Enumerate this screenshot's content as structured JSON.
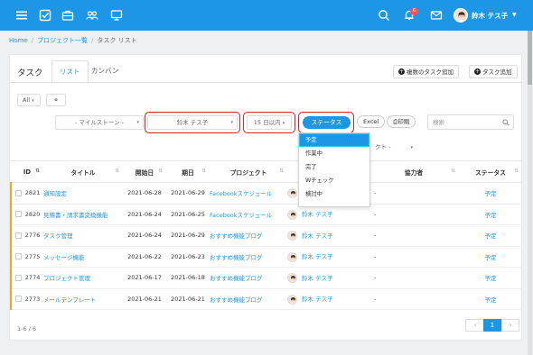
{
  "topbar": {
    "icons": [
      "menu-icon",
      "task-check-icon",
      "briefcase-icon",
      "users-icon",
      "monitor-icon",
      "search-icon",
      "bell-icon",
      "mail-icon"
    ],
    "notification_count": "6",
    "user_name": "鈴木 テス子",
    "accent_color": "#1e96e6"
  },
  "breadcrumb": {
    "home": "Home",
    "projects": "プロジェクト一覧",
    "current": "タスク リスト"
  },
  "page": {
    "title": "タスク",
    "tabs": [
      "リスト",
      "カンバン"
    ],
    "add_multiple": "複数のタスク追加",
    "add_task": "タスク追加"
  },
  "filters": {
    "view_all": "All",
    "milestone": "- マイルストーン -",
    "assignee": "鈴木 テス子",
    "deadline": "15 日以内",
    "status_button": "ステータス",
    "excel": "Excel",
    "print": "印刷",
    "search_placeholder": "検索",
    "project_partial": "クト -"
  },
  "status_dropdown": {
    "options": [
      "予定",
      "作業中",
      "完了",
      "Wチェック",
      "検討中"
    ],
    "selected": "予定"
  },
  "table": {
    "columns": [
      "ID",
      "タイトル",
      "開始日",
      "期日",
      "プロジェクト",
      "",
      "協力者",
      "ステータス"
    ],
    "rows": [
      {
        "id": "2821",
        "title": "通知設定",
        "start": "2021-06-28",
        "due": "2021-06-29",
        "project": "Facebookスケジュール",
        "assignee": "鈴木 テス子",
        "collaborator": "-",
        "status": "予定"
      },
      {
        "id": "2820",
        "title": "見積書・請求書変換機能",
        "start": "2021-06-24",
        "due": "2021-06-25",
        "project": "Facebookスケジュール",
        "assignee": "鈴木 テス子",
        "collaborator": "-",
        "status": "予定"
      },
      {
        "id": "2776",
        "title": "タスク管理",
        "start": "2021-06-24",
        "due": "2021-06-29",
        "project": "おすすめ機能ブログ",
        "assignee": "鈴木 テス子",
        "collaborator": "-",
        "status": "予定"
      },
      {
        "id": "2775",
        "title": "メッセージ機能",
        "start": "2021-06-22",
        "due": "2021-06-23",
        "project": "おすすめ機能ブログ",
        "assignee": "鈴木 テス子",
        "collaborator": "-",
        "status": "予定"
      },
      {
        "id": "2774",
        "title": "プロジェクト管理",
        "start": "2021-06-17",
        "due": "2021-06-18",
        "project": "おすすめ機能ブログ",
        "assignee": "鈴木 テス子",
        "collaborator": "-",
        "status": "予定"
      },
      {
        "id": "2773",
        "title": "メールテンプレート",
        "start": "2021-06-21",
        "due": "2021-06-21",
        "project": "おすすめ機能ブログ",
        "assignee": "鈴木 テス子",
        "collaborator": "-",
        "status": "予定"
      }
    ]
  },
  "footer": {
    "count": "1-6 / 6",
    "prev": "‹",
    "page": "1",
    "next": "›"
  }
}
